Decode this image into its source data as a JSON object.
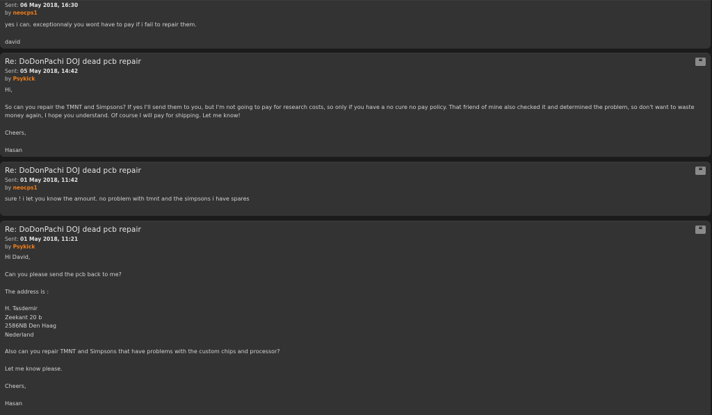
{
  "posts": [
    {
      "sent_label": "Sent:",
      "sent_date": "06 May 2018, 16:30",
      "by_label": "by",
      "author": "neocps1",
      "body": [
        "yes i can. exceptionnaly you wont have to pay if i fail to repair them.",
        "",
        "david"
      ]
    },
    {
      "title": "Re: DoDonPachi DOJ dead pcb repair",
      "sent_label": "Sent:",
      "sent_date": "05 May 2018, 14:42",
      "by_label": "by",
      "author": "Psykick",
      "body": [
        "Hi,",
        "",
        "So can you repair the TMNT and Simpsons? If yes I'll send them to you, but I'm not going to pay for research costs, so only if you have a no cure no pay policy. That friend of mine also checked it and determined the problem, so don't want to waste",
        "money again, I hope you understand. Of course I will pay for shipping. Let me know!",
        "",
        "Cheers,",
        "",
        "Hasan"
      ]
    },
    {
      "title": "Re: DoDonPachi DOJ dead pcb repair",
      "sent_label": "Sent:",
      "sent_date": "01 May 2018, 11:42",
      "by_label": "by",
      "author": "neocps1",
      "body": [
        "sure ! i let you know the amount. no problem with tmnt and the simpsons i have spares"
      ]
    },
    {
      "title": "Re: DoDonPachi DOJ dead pcb repair",
      "sent_label": "Sent:",
      "sent_date": "01 May 2018, 11:21",
      "by_label": "by",
      "author": "Psykick",
      "body": [
        "Hi David,",
        "",
        "Can you please send the pcb back to me?",
        "",
        "The address is :",
        "",
        "H. Tasdemir",
        "Zeekant 20 b",
        "2586NB Den Haag",
        "Nederland",
        "",
        "Also can you repair TMNT and Simpsons that have problems with the custom chips and processor?",
        "",
        "Let me know please.",
        "",
        "Cheers,",
        "",
        "Hasan"
      ]
    }
  ],
  "icons": {
    "quote": "quote-icon"
  },
  "colors": {
    "author": "#ef7d1a",
    "panel": "#333333",
    "background": "#1b1b1b"
  }
}
